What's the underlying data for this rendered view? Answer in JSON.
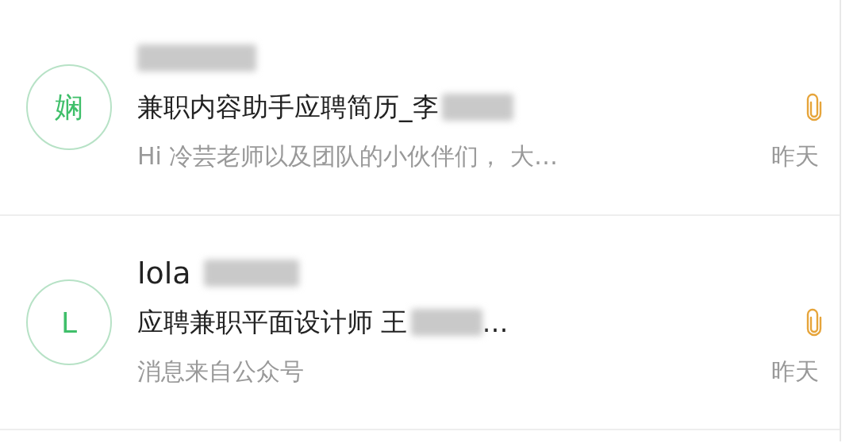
{
  "messages": [
    {
      "avatar": "娴",
      "subject": "兼职内容助手应聘简历_李",
      "preview": "Hi 冷芸老师以及团队的小伙伴们， 大…",
      "time": "昨天",
      "attachment": true
    },
    {
      "avatar": "L",
      "sender": "lola",
      "subject": "应聘兼职平面设计师 王",
      "subject_tail": "…",
      "preview": "消息来自公众号",
      "time": "昨天",
      "attachment": true
    }
  ]
}
